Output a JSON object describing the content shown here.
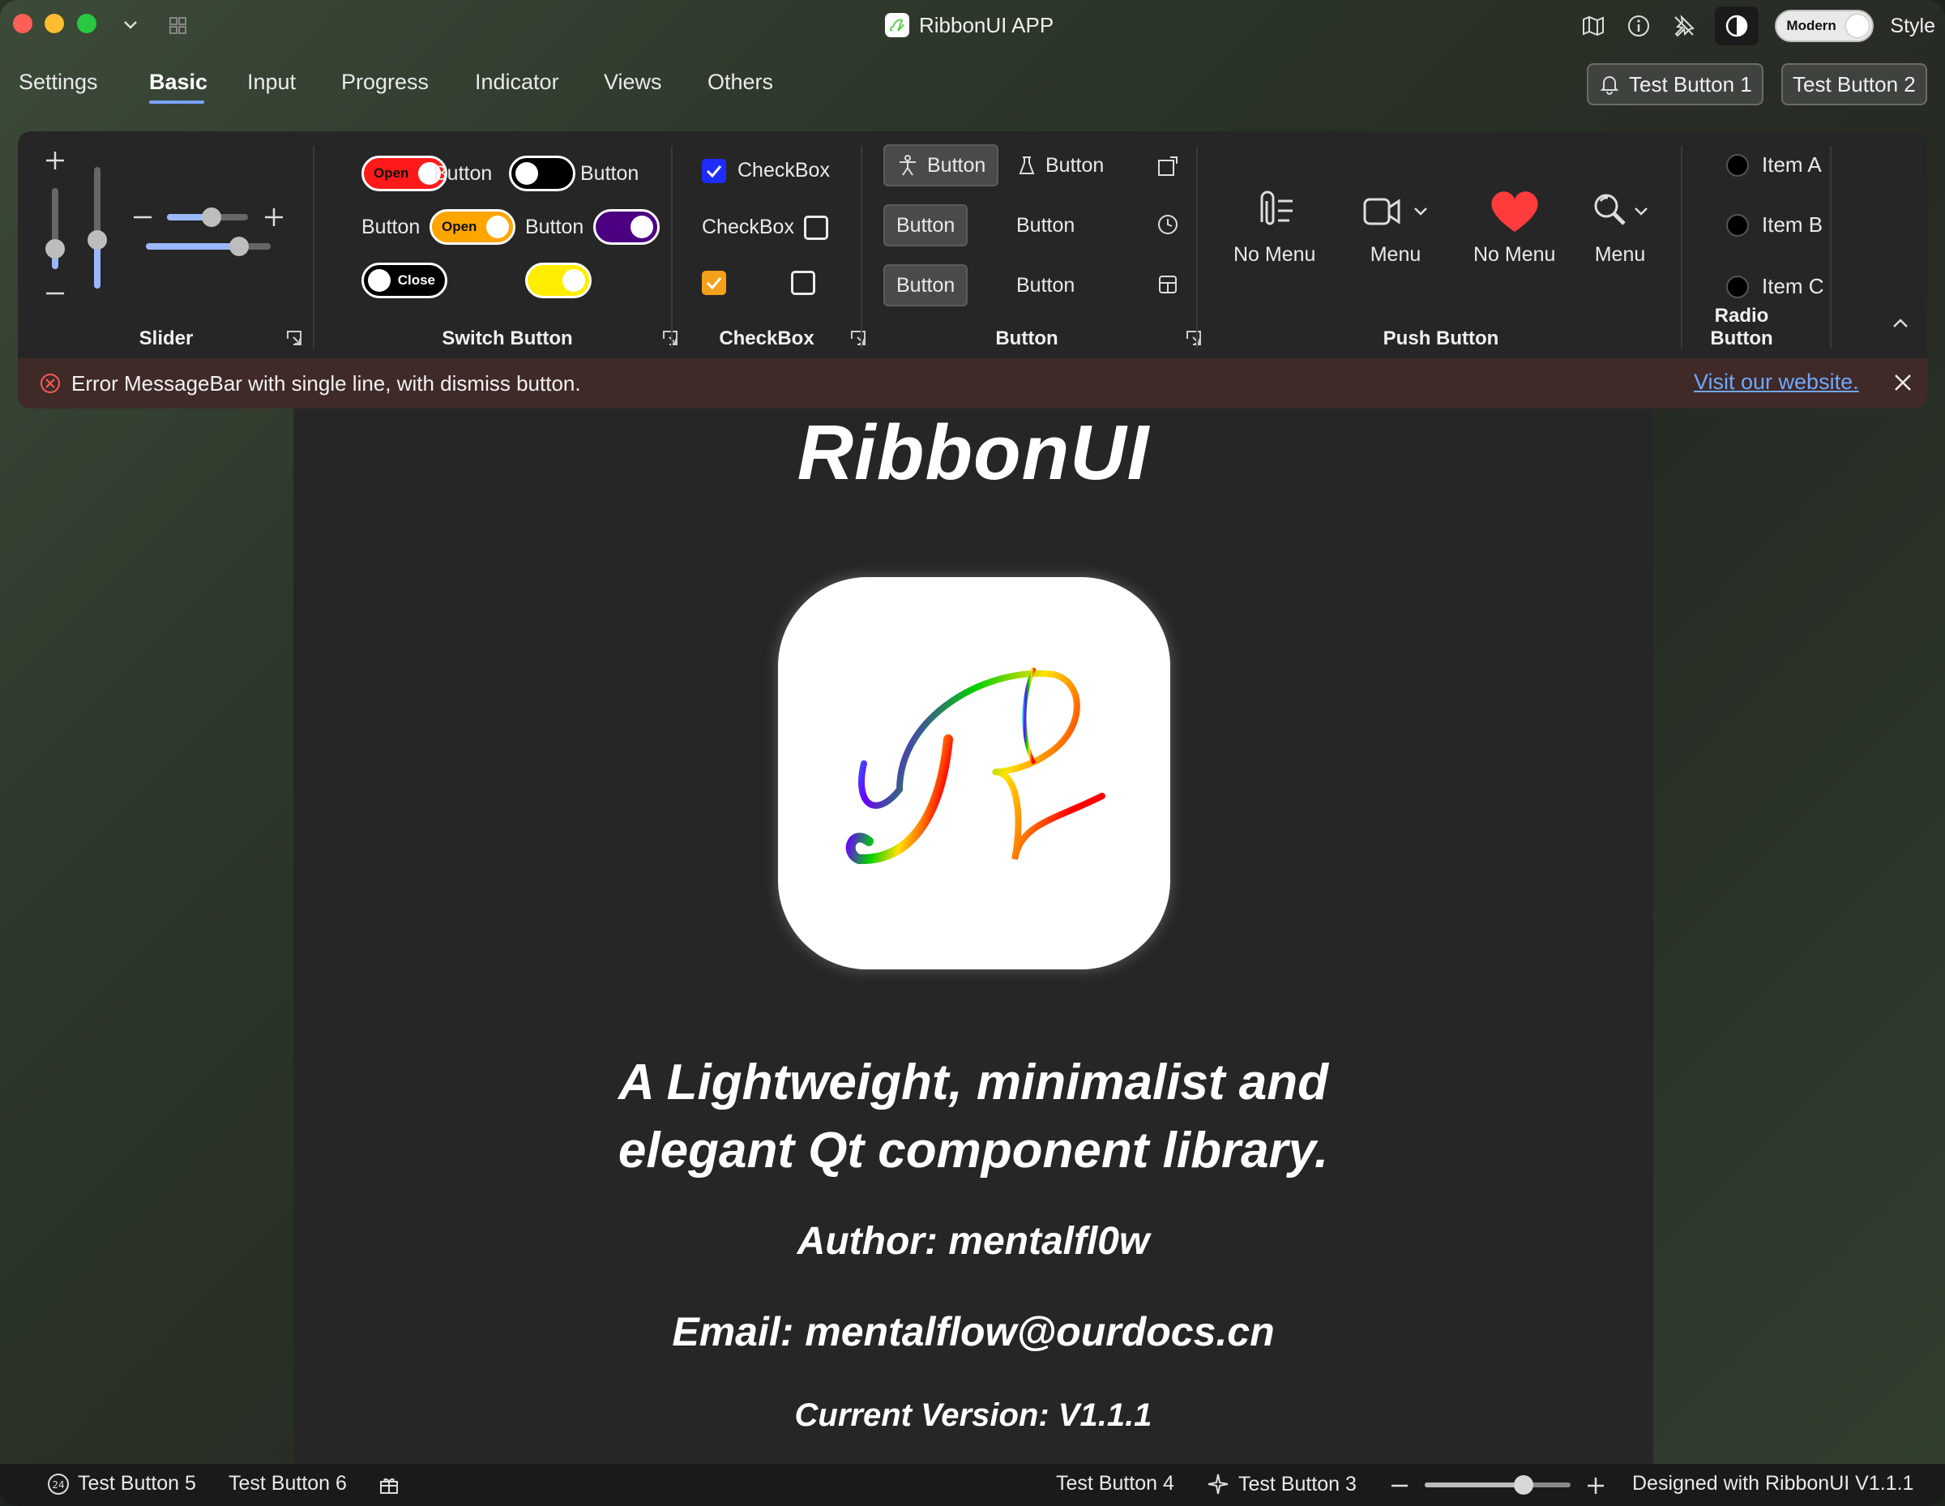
{
  "window": {
    "title": "RibbonUI APP"
  },
  "titlebar": {
    "style_toggle_label": "Modern",
    "style_label": "Style"
  },
  "tabs": [
    "Settings",
    "Basic",
    "Input",
    "Progress",
    "Indicator",
    "Views",
    "Others"
  ],
  "active_tab": "Basic",
  "top_buttons": {
    "test1": "Test Button 1",
    "test2": "Test Button 2"
  },
  "ribbon": {
    "slider": {
      "label": "Slider",
      "vertical_1_value": 0.25,
      "vertical_2_value": 0.4,
      "horizontal_1_value": 0.55,
      "horizontal_2_value": 0.75
    },
    "switch": {
      "label": "Switch Button",
      "button_text": "Button",
      "open_text": "Open",
      "close_text": "Close"
    },
    "checkbox": {
      "label": "CheckBox",
      "item_text": "CheckBox"
    },
    "button": {
      "label": "Button",
      "text": "Button"
    },
    "push": {
      "label": "Push Button",
      "items": [
        "No Menu",
        "Menu",
        "No Menu",
        "Menu"
      ]
    },
    "radio": {
      "label": "Radio Button",
      "items": [
        "Item A",
        "Item B",
        "Item C"
      ]
    }
  },
  "messagebar": {
    "text": "Error MessageBar with single line, with dismiss button.",
    "link": "Visit our website."
  },
  "about": {
    "title": "RibbonUI",
    "tagline_1": "A Lightweight, minimalist and",
    "tagline_2": "elegant Qt component library.",
    "author": "Author: mentalfl0w",
    "email": "Email: mentalflow@ourdocs.cn",
    "version": "Current Version: V1.1.1"
  },
  "statusbar": {
    "badge": "24",
    "test5": "Test Button 5",
    "test6": "Test Button 6",
    "test4": "Test Button 4",
    "test3": "Test Button 3",
    "zoom_value": 0.68,
    "credit": "Designed with RibbonUI V1.1.1"
  },
  "colors": {
    "accent": "#7aa2ff",
    "switch_red": "#ff1a1a",
    "switch_orange": "#ffa500",
    "switch_purple": "#4b0082",
    "switch_yellow": "#ffee00",
    "error_bar": "#3f2a28",
    "heart": "#ff3b3b"
  }
}
